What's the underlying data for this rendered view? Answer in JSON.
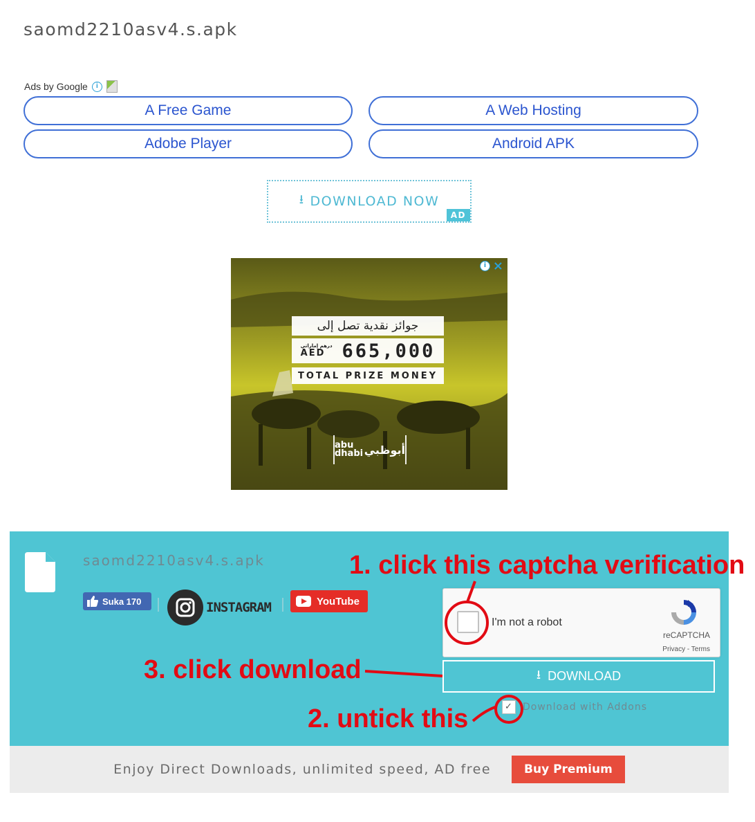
{
  "page": {
    "title": "saomd2210asv4.s.apk"
  },
  "ads": {
    "label": "Ads by Google",
    "links": [
      "A Free Game",
      "A Web Hosting",
      "Adobe Player",
      "Android APK"
    ]
  },
  "download_now_ad": {
    "label": "DOWNLOAD NOW",
    "badge": "AD"
  },
  "banner_ad": {
    "arabic_headline": "جوائز نقدية تصل إلى",
    "currency": "AED",
    "currency_arabic": "درهم إماراتي",
    "amount": "665,000",
    "total_label": "TOTAL PRIZE MONEY",
    "brand_en": "abu dhabi",
    "brand_ar": "أبوظبي"
  },
  "download_panel": {
    "filename": "saomd2210asv4.s.apk",
    "facebook": {
      "label": "Suka 170"
    },
    "instagram": {
      "label": "INSTAGRAM"
    },
    "youtube": {
      "label": "YouTube"
    },
    "captcha": {
      "label": "I'm not a robot",
      "brand": "reCAPTCHA",
      "links": "Privacy - Terms"
    },
    "download_button": "DOWNLOAD",
    "addons_label": "Download with Addons",
    "addons_checked": true
  },
  "premium": {
    "text": "Enjoy Direct Downloads, unlimited speed, AD free",
    "button": "Buy Premium"
  },
  "annotations": {
    "step1": "1. click this captcha verification",
    "step2": "2. untick this",
    "step3": "3. click download"
  },
  "colors": {
    "panel": "#4fc5d3",
    "annotation": "#e20b14",
    "premium_button": "#e74c3c",
    "link_border": "#3f6fd6"
  }
}
